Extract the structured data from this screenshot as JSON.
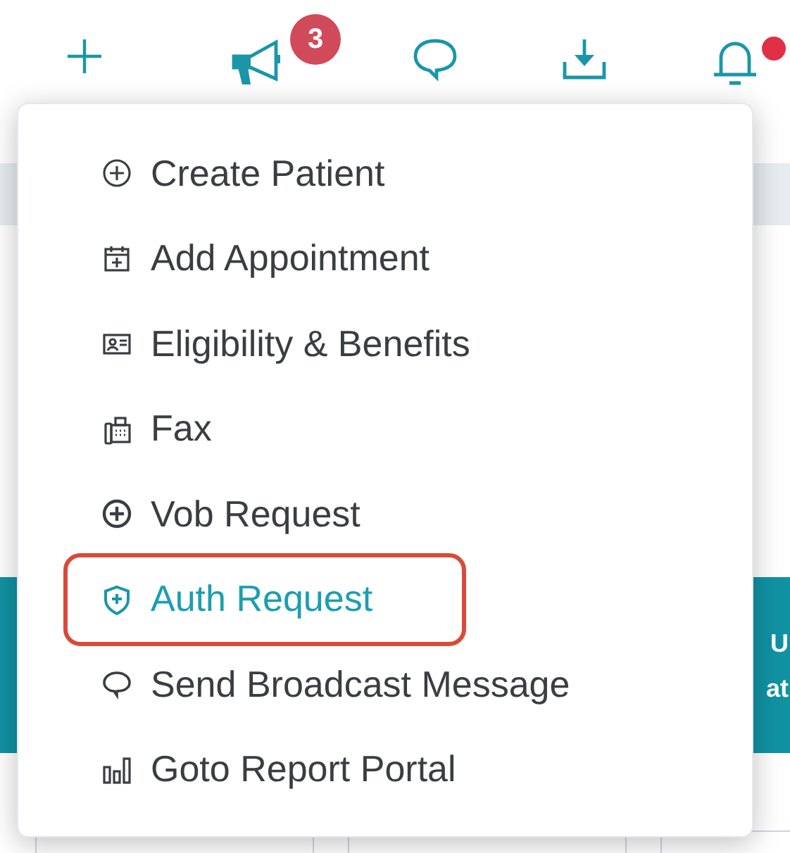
{
  "toolbar": [
    {
      "kind": "plus"
    },
    {
      "kind": "megaphone",
      "badge": "3"
    },
    {
      "kind": "chat"
    },
    {
      "kind": "download"
    },
    {
      "kind": "bell",
      "dot": true
    }
  ],
  "banner": {
    "text_1": "U",
    "text_2": "at"
  },
  "menu": [
    {
      "kind": "circle-plus",
      "label": "Create Patient",
      "selected": false
    },
    {
      "kind": "calendar",
      "label": "Add Appointment",
      "selected": false
    },
    {
      "kind": "id-card",
      "label": "Eligibility & Benefits",
      "selected": false
    },
    {
      "kind": "fax",
      "label": "Fax",
      "selected": false
    },
    {
      "kind": "circle-plus-bold",
      "label": "Vob Request",
      "selected": false
    },
    {
      "kind": "shield",
      "label": "Auth Request",
      "selected": true
    },
    {
      "kind": "chat",
      "label": "Send Broadcast Message",
      "selected": false
    },
    {
      "kind": "chart",
      "label": "Goto Report Portal",
      "selected": false
    }
  ]
}
